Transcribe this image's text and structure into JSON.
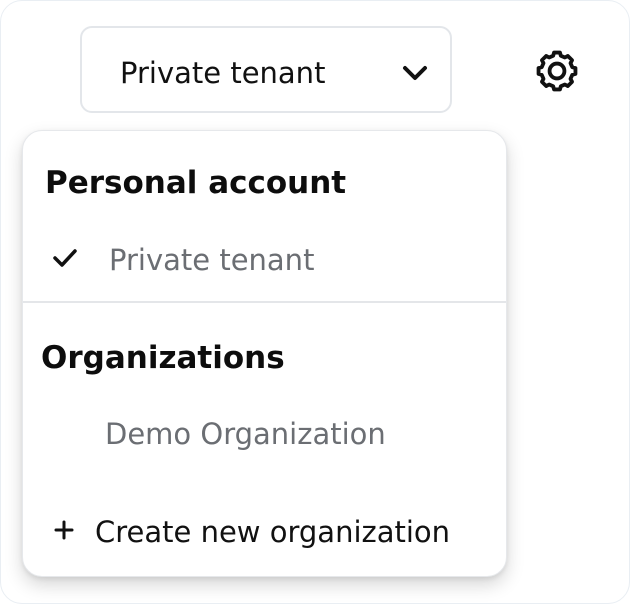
{
  "tenant_selector": {
    "selected": "Private tenant",
    "icon": "chevron-down-icon"
  },
  "settings": {
    "icon": "gear-icon"
  },
  "menu": {
    "personal_section": {
      "title": "Personal account",
      "items": [
        {
          "label": "Private tenant",
          "selected": true,
          "icon": "check-icon"
        }
      ]
    },
    "organizations_section": {
      "title": "Organizations",
      "items": [
        {
          "label": "Demo Organization"
        }
      ]
    },
    "create_action": {
      "label": "Create new organization",
      "icon": "plus-icon"
    }
  },
  "colors": {
    "text_primary": "#111111",
    "text_muted": "#6b6e73",
    "border": "#e3e6ea"
  }
}
